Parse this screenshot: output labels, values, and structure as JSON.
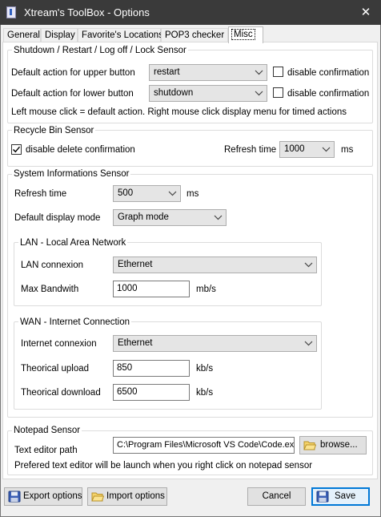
{
  "window": {
    "title": "Xtream's ToolBox - Options",
    "close_glyph": "✕"
  },
  "tabs": [
    {
      "label": "General"
    },
    {
      "label": "Display"
    },
    {
      "label": "Favorite's Locations"
    },
    {
      "label": "POP3 checker"
    },
    {
      "label": "Misc"
    }
  ],
  "active_tab": "Misc",
  "shutdown": {
    "legend": "Shutdown / Restart / Log off / Lock Sensor",
    "upper_label": "Default action for upper button",
    "upper_value": "restart",
    "upper_disable_label": "disable confirmation",
    "upper_disable_checked": false,
    "lower_label": "Default action for lower button",
    "lower_value": "shutdown",
    "lower_disable_label": "disable confirmation",
    "lower_disable_checked": false,
    "hint": "Left mouse click = default action. Right mouse click display menu for timed actions"
  },
  "recycle": {
    "legend": "Recycle Bin Sensor",
    "disable_delete_label": "disable delete confirmation",
    "disable_delete_checked": true,
    "refresh_label": "Refresh time",
    "refresh_value": "1000",
    "refresh_unit": "ms"
  },
  "sysinfo": {
    "legend": "System Informations Sensor",
    "refresh_label": "Refresh time",
    "refresh_value": "500",
    "refresh_unit": "ms",
    "display_mode_label": "Default display mode",
    "display_mode_value": "Graph mode",
    "lan": {
      "legend": "LAN - Local Area Network",
      "connexion_label": "LAN connexion",
      "connexion_value": "Ethernet",
      "bandwidth_label": "Max Bandwith",
      "bandwidth_value": "1000",
      "bandwidth_unit": "mb/s"
    },
    "wan": {
      "legend": "WAN - Internet Connection",
      "connexion_label": "Internet connexion",
      "connexion_value": "Ethernet",
      "upload_label": "Theorical upload",
      "upload_value": "850",
      "upload_unit": "kb/s",
      "download_label": "Theorical download",
      "download_value": "6500",
      "download_unit": "kb/s"
    }
  },
  "notepad": {
    "legend": "Notepad Sensor",
    "path_label": "Text editor path",
    "path_value": "C:\\Program Files\\Microsoft VS Code\\Code.exe",
    "browse_label": "browse...",
    "hint": "Prefered text editor will be launch when you right click on notepad sensor"
  },
  "footer": {
    "export_label": "Export options",
    "import_label": "Import options",
    "cancel_label": "Cancel",
    "save_label": "Save"
  },
  "icons": {
    "app": "app-icon",
    "close": "close-icon",
    "chevron": "chevron-down-icon",
    "check": "checkmark-icon",
    "folder": "folder-icon",
    "disk": "floppy-disk-icon"
  },
  "colors": {
    "titlebar": "#3a3a3a",
    "accent_focus": "#0078d7",
    "panel": "#ffffff",
    "window": "#f0f0f0"
  }
}
